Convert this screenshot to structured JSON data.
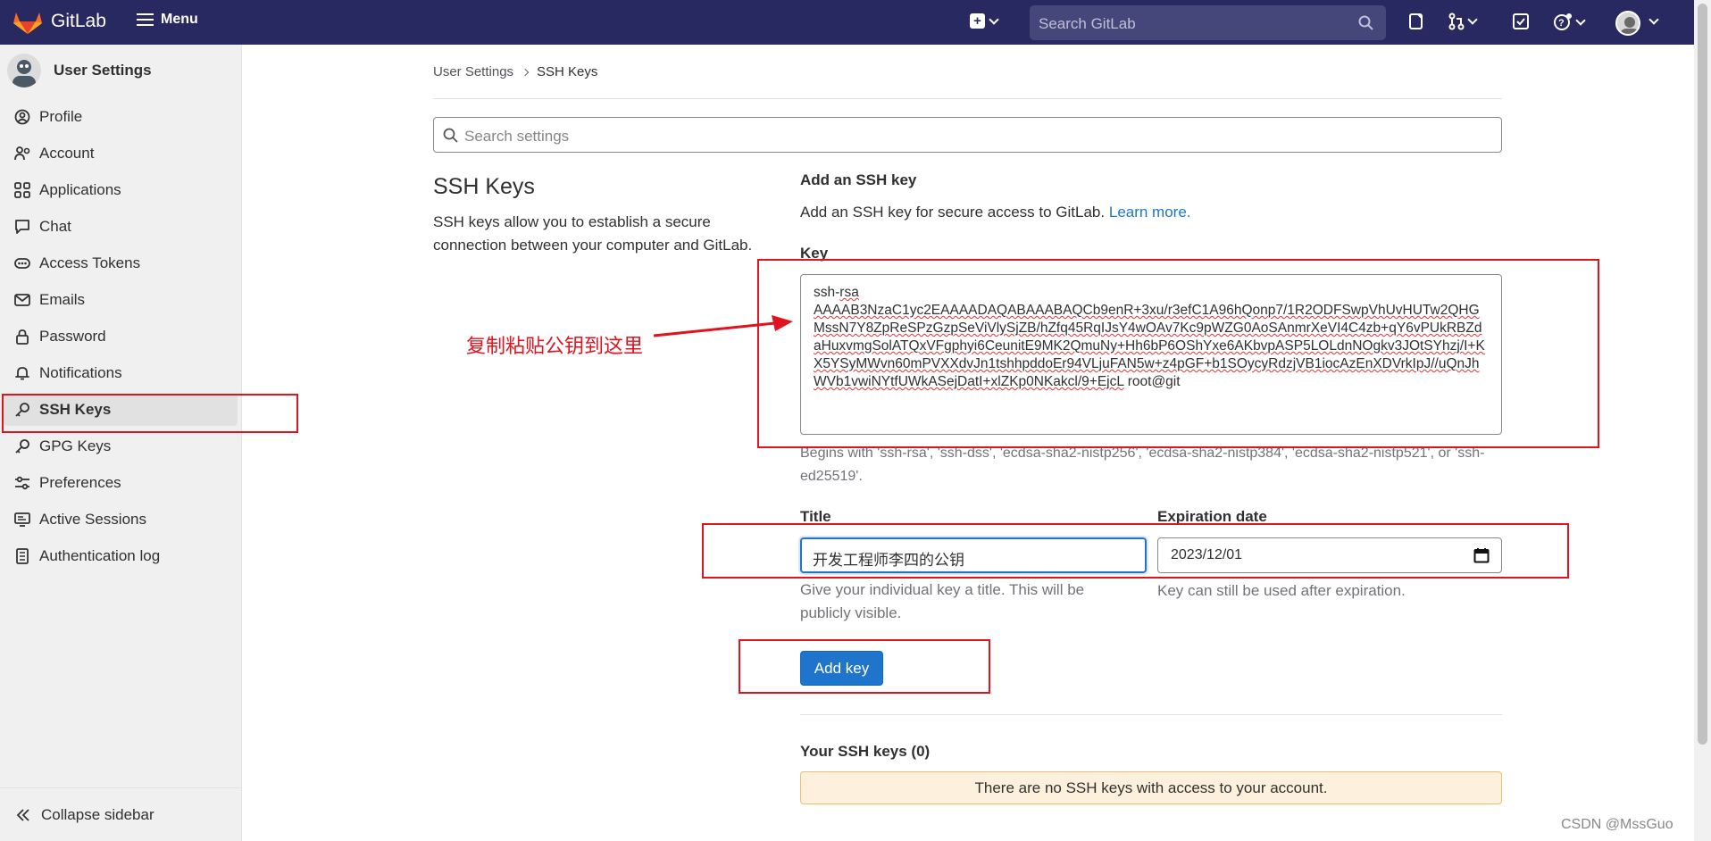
{
  "navbar": {
    "brand": "GitLab",
    "menu_label": "Menu",
    "search_placeholder": "Search GitLab",
    "icons": [
      "plus-square-icon",
      "search-icon",
      "issues-icon",
      "merge-request-icon",
      "todo-icon",
      "help-icon",
      "avatar"
    ]
  },
  "sidebar": {
    "title": "User Settings",
    "items": [
      {
        "label": "Profile",
        "icon": "profile-icon"
      },
      {
        "label": "Account",
        "icon": "account-icon"
      },
      {
        "label": "Applications",
        "icon": "applications-icon"
      },
      {
        "label": "Chat",
        "icon": "chat-icon"
      },
      {
        "label": "Access Tokens",
        "icon": "token-icon"
      },
      {
        "label": "Emails",
        "icon": "mail-icon"
      },
      {
        "label": "Password",
        "icon": "lock-icon"
      },
      {
        "label": "Notifications",
        "icon": "bell-icon"
      },
      {
        "label": "SSH Keys",
        "icon": "key-icon",
        "active": true
      },
      {
        "label": "GPG Keys",
        "icon": "key-icon"
      },
      {
        "label": "Preferences",
        "icon": "preferences-icon"
      },
      {
        "label": "Active Sessions",
        "icon": "monitor-icon"
      },
      {
        "label": "Authentication log",
        "icon": "log-icon"
      }
    ],
    "collapse_label": "Collapse sidebar"
  },
  "breadcrumb": {
    "parent": "User Settings",
    "current": "SSH Keys"
  },
  "settings_search_placeholder": "Search settings",
  "section": {
    "title": "SSH Keys",
    "description": "SSH keys allow you to establish a secure connection between your computer and GitLab."
  },
  "form": {
    "heading": "Add an SSH key",
    "intro": "Add an SSH key for secure access to GitLab.",
    "learn_more": "Learn more.",
    "key_label": "Key",
    "key_prefix": "ssh-",
    "key_prefix_sq": "rsa",
    "key_body": "AAAAB3NzaC1yc2EAAAADAQABAAABAQCb9enR+3xu/r3efC1A96hQonp7/1R2ODFSwpVhUvHUTw2QHGMssN7Y8ZpReSPzGzpSeViVlySjZB/hZfq45RqIJsY4wOAv7Kc9pWZG0AoSAnmrXeVI4C4zb+qY6vPUkRBZdaHuxvmgSolATQxVFgphyi6CeunitE9MK2QmuNy+Hh6bP6OShYxe6AKbvpASP5LOLdnNOgkv3JOtSYhzj/I+KX5YSyMWvn60mPVXXdvJn1tshhpddoEr94VLjuFAN5w+z4pGF+b1SOycyRdzjVB1iocAzEnXDVrkIpJ//uQnJhWVb1vwiNYtfUWkASejDatI+xlZKp0NKakcl/9+EjcL",
    "key_suffix": " root@git",
    "key_help": "Begins with 'ssh-rsa', 'ssh-dss', 'ecdsa-sha2-nistp256', 'ecdsa-sha2-nistp384', 'ecdsa-sha2-nistp521', or 'ssh-ed25519'.",
    "title_label": "Title",
    "title_value": "开发工程师李四的公钥",
    "title_help": "Give your individual key a title. This will be publicly visible.",
    "expiration_label": "Expiration date",
    "expiration_value": "2023/12/01",
    "expiration_help": "Key can still be used after expiration.",
    "submit_label": "Add key"
  },
  "your_keys": {
    "heading": "Your SSH keys (0)",
    "empty_message": "There are no SSH keys with access to your account."
  },
  "annotation": {
    "text": "复制粘贴公钥到这里",
    "color": "#e0141f"
  },
  "watermark": "CSDN @MssGuo"
}
